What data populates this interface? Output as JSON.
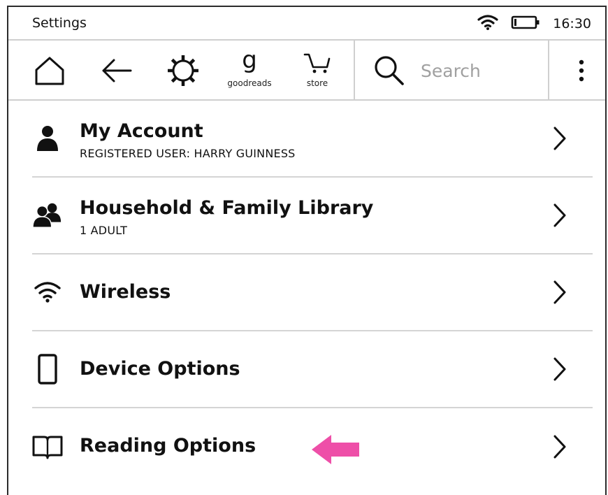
{
  "status_bar": {
    "title": "Settings",
    "time": "16:30"
  },
  "toolbar": {
    "home_icon": "home-icon",
    "back_icon": "back-arrow-icon",
    "settings_icon": "gear-icon",
    "goodreads_glyph": "g",
    "goodreads_label": "goodreads",
    "store_label": "store",
    "search_placeholder": "Search",
    "menu_icon": "vertical-dots-icon"
  },
  "settings": {
    "items": [
      {
        "icon": "person-icon",
        "title": "My Account",
        "subtitle": "REGISTERED USER: HARRY GUINNESS"
      },
      {
        "icon": "people-icon",
        "title": "Household & Family Library",
        "subtitle": "1 ADULT"
      },
      {
        "icon": "wifi-icon",
        "title": "Wireless",
        "subtitle": ""
      },
      {
        "icon": "device-icon",
        "title": "Device Options",
        "subtitle": ""
      },
      {
        "icon": "book-icon",
        "title": "Reading Options",
        "subtitle": ""
      }
    ]
  },
  "colors": {
    "highlight_arrow": "#ee4fa8",
    "divider": "#d4d4d4",
    "text": "#111111",
    "placeholder": "#a0a0a0"
  }
}
